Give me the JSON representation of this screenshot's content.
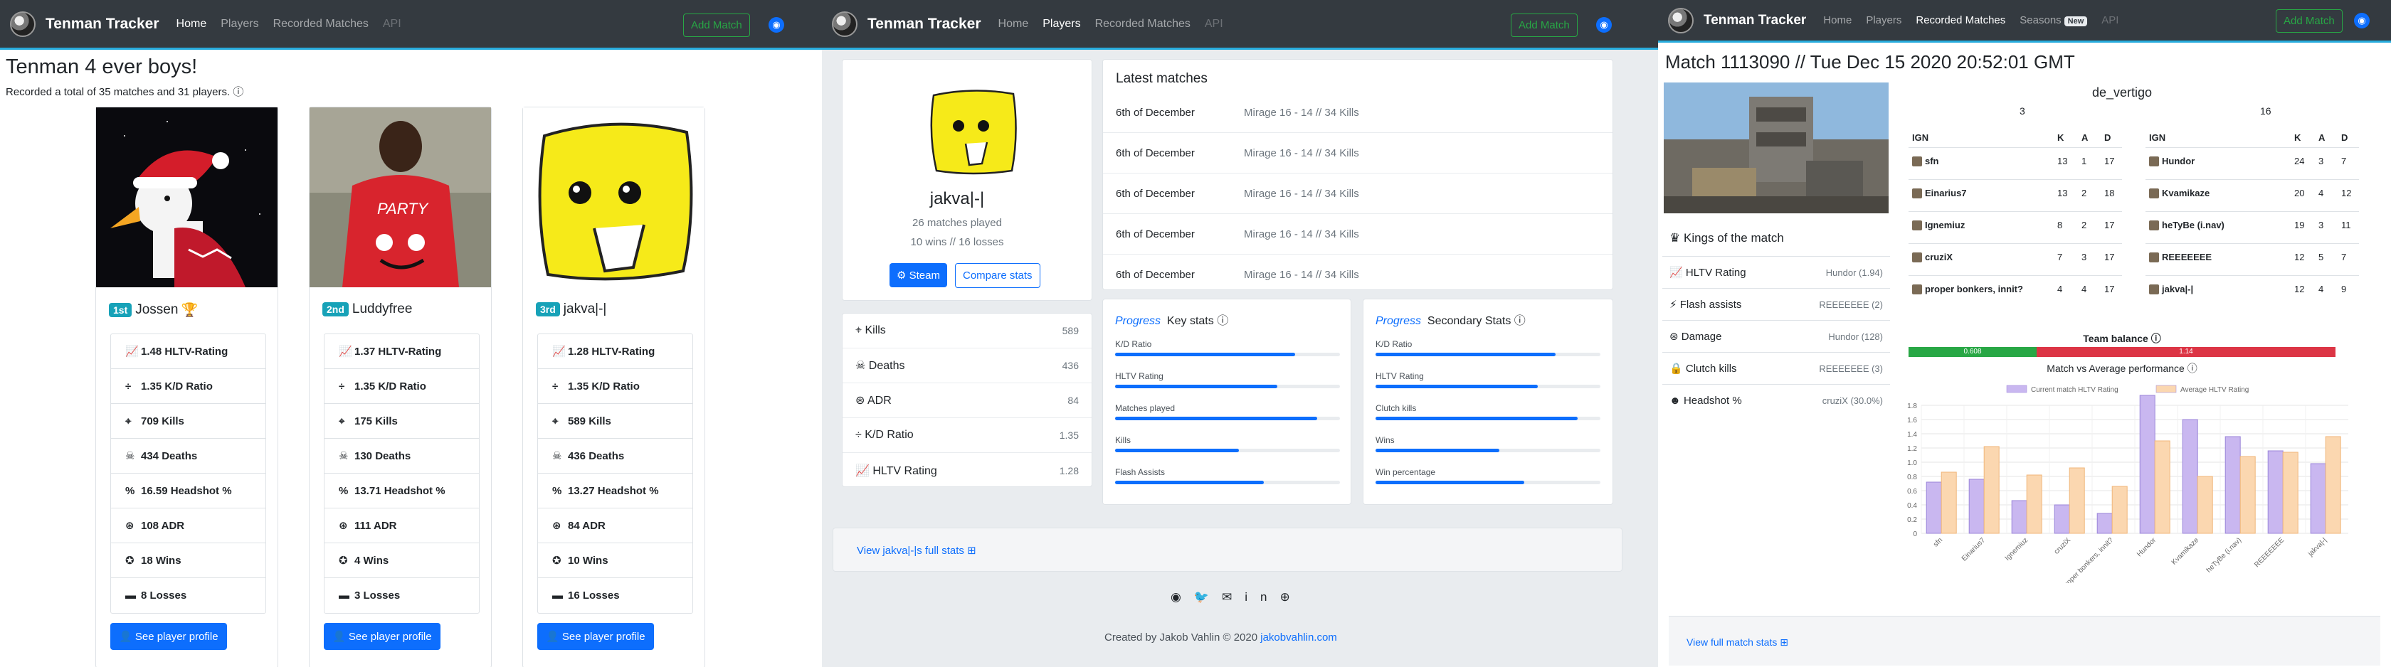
{
  "panel1": {
    "brand": "Tenman Tracker",
    "nav": [
      "Home",
      "Players",
      "Recorded Matches",
      "API"
    ],
    "add_match": "Add Match",
    "heading": "Tenman 4 ever boys!",
    "subheading": "Recorded a total of 35 matches and 31 players.",
    "info_icon": "info-icon",
    "players": [
      {
        "rank": "1st",
        "name": "Jossen",
        "trophy": "trophy-icon",
        "hltv": "1.48 HLTV-Rating",
        "kd": "1.35 K/D Ratio",
        "kills": "709 Kills",
        "deaths": "434 Deaths",
        "hs": "16.59 Headshot %",
        "adr": "108 ADR",
        "wins": "18 Wins",
        "losses": "8 Losses",
        "button": "See player profile"
      },
      {
        "rank": "2nd",
        "name": "Luddyfree",
        "trophy": "",
        "hltv": "1.37 HLTV-Rating",
        "kd": "1.35 K/D Ratio",
        "kills": "175 Kills",
        "deaths": "130 Deaths",
        "hs": "13.71 Headshot %",
        "adr": "111 ADR",
        "wins": "4 Wins",
        "losses": "3 Losses",
        "button": "See player profile"
      },
      {
        "rank": "3rd",
        "name": "jakva|-|",
        "trophy": "",
        "hltv": "1.28 HLTV-Rating",
        "kd": "1.35 K/D Ratio",
        "kills": "589 Kills",
        "deaths": "436 Deaths",
        "hs": "13.27 Headshot %",
        "adr": "84 ADR",
        "wins": "10 Wins",
        "losses": "16 Losses",
        "button": "See player profile"
      }
    ]
  },
  "panel2": {
    "brand": "Tenman Tracker",
    "nav": [
      "Home",
      "Players",
      "Recorded Matches",
      "API"
    ],
    "add_match": "Add Match",
    "player_name": "jakva|-|",
    "matches_played": "26 matches played",
    "wins_losses": "10 wins // 16 losses",
    "steam": "Steam",
    "compare": "Compare stats",
    "key_values": [
      {
        "label": "Kills",
        "value": "589",
        "icon": "crosshair-icon"
      },
      {
        "label": "Deaths",
        "value": "436",
        "icon": "skull-icon"
      },
      {
        "label": "ADR",
        "value": "84",
        "icon": "adr-icon"
      },
      {
        "label": "K/D Ratio",
        "value": "1.35",
        "icon": "divide-icon"
      },
      {
        "label": "HLTV Rating",
        "value": "1.28",
        "icon": "chart-icon"
      }
    ],
    "latest_title": "Latest matches",
    "latest": [
      {
        "date": "6th of December",
        "result": "Mirage 16 - 14 // 34 Kills"
      },
      {
        "date": "6th of December",
        "result": "Mirage 16 - 14 // 34 Kills"
      },
      {
        "date": "6th of December",
        "result": "Mirage 16 - 14 // 34 Kills"
      },
      {
        "date": "6th of December",
        "result": "Mirage 16 - 14 // 34 Kills"
      },
      {
        "date": "6th of December",
        "result": "Mirage 16 - 14 // 34 Kills"
      }
    ],
    "progress_word": "Progress",
    "key_stats_title": "Key stats",
    "secondary_title": "Secondary Stats",
    "key_stats": [
      {
        "label": "K/D Ratio",
        "fill": 0.8
      },
      {
        "label": "HLTV Rating",
        "fill": 0.72
      },
      {
        "label": "Matches played",
        "fill": 0.9
      },
      {
        "label": "Kills",
        "fill": 0.55
      },
      {
        "label": "Flash Assists",
        "fill": 0.66
      }
    ],
    "secondary_stats": [
      {
        "label": "K/D Ratio",
        "fill": 0.8
      },
      {
        "label": "HLTV Rating",
        "fill": 0.72
      },
      {
        "label": "Clutch kills",
        "fill": 0.9
      },
      {
        "label": "Wins",
        "fill": 0.55
      },
      {
        "label": "Win percentage",
        "fill": 0.66
      }
    ],
    "full_stats": "View jakva|-|s full stats",
    "footer": "Created by Jakob Vahlin © 2020",
    "footer_link": "jakobvahlin.com"
  },
  "panel3": {
    "brand": "Tenman Tracker",
    "nav": [
      "Home",
      "Players",
      "Recorded Matches",
      "Seasons",
      "API"
    ],
    "new_badge": "New",
    "add_match": "Add Match",
    "match_title": "Match 1113090 // Tue Dec 15 2020 20:52:01 GMT",
    "map": "de_vertigo",
    "score_left": "3",
    "score_right": "16",
    "headers": [
      "IGN",
      "K",
      "A",
      "D"
    ],
    "team_left": [
      {
        "ign": "sfn",
        "k": "13",
        "a": "1",
        "d": "17"
      },
      {
        "ign": "Einarius7",
        "k": "13",
        "a": "2",
        "d": "18"
      },
      {
        "ign": "Ignemiuz",
        "k": "8",
        "a": "2",
        "d": "17"
      },
      {
        "ign": "cruziX",
        "k": "7",
        "a": "3",
        "d": "17"
      },
      {
        "ign": "proper bonkers, innit?",
        "k": "4",
        "a": "4",
        "d": "17"
      }
    ],
    "team_right": [
      {
        "ign": "Hundor",
        "k": "24",
        "a": "3",
        "d": "7"
      },
      {
        "ign": "Kvamikaze",
        "k": "20",
        "a": "4",
        "d": "12"
      },
      {
        "ign": "heTyBe (i.nav)",
        "k": "19",
        "a": "3",
        "d": "11"
      },
      {
        "ign": "REEEEEEE",
        "k": "12",
        "a": "5",
        "d": "7"
      },
      {
        "ign": "jakva|-|",
        "k": "12",
        "a": "4",
        "d": "9"
      }
    ],
    "kings_title": "Kings of the match",
    "kings": [
      {
        "label": "HLTV Rating",
        "value": "Hundor (1.94)"
      },
      {
        "label": "Flash assists",
        "value": "REEEEEEE (2)"
      },
      {
        "label": "Damage",
        "value": "Hundor (128)"
      },
      {
        "label": "Clutch kills",
        "value": "REEEEEEE (3)"
      },
      {
        "label": "Headshot %",
        "value": "cruziX (30.0%)"
      }
    ],
    "team_balance": "Team balance",
    "balance_left": "0.608",
    "balance_right": "1.14",
    "balance_fill": 0.3,
    "perf_title": "Match vs Average performance",
    "full_match": "View full match stats"
  },
  "chart_data": {
    "type": "bar",
    "categories": [
      "sfn",
      "Einarius7",
      "Ignemiuz",
      "cruziX",
      "proper bonkers, innit?",
      "Hundor",
      "Kvamikaze",
      "heTyBe (i.nav)",
      "REEEEEEE",
      "jakva|-|"
    ],
    "series": [
      {
        "name": "Current match HLTV Rating",
        "values": [
          0.72,
          0.76,
          0.46,
          0.4,
          0.28,
          1.94,
          1.6,
          1.36,
          1.16,
          0.98
        ],
        "color": "#c9b7f0"
      },
      {
        "name": "Average HLTV Rating",
        "values": [
          0.86,
          1.22,
          0.82,
          0.92,
          0.66,
          1.3,
          0.8,
          1.08,
          1.14,
          1.36
        ],
        "color": "#fbd7b0"
      }
    ],
    "ylim": [
      0,
      1.8
    ],
    "yticks": [
      "0",
      "0.2",
      "0.4",
      "0.6",
      "0.8",
      "1.0",
      "1.2",
      "1.4",
      "1.6",
      "1.8"
    ]
  }
}
